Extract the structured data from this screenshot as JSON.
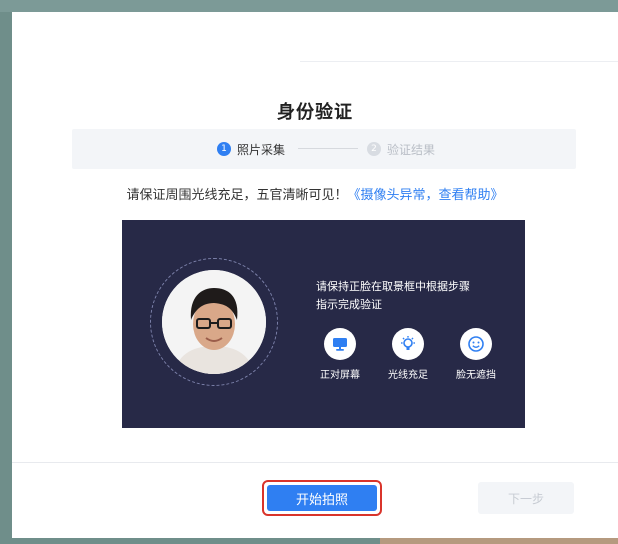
{
  "dialog": {
    "title": "身份验证",
    "steps": [
      {
        "index": "1",
        "label": "照片采集",
        "active": true
      },
      {
        "index": "2",
        "label": "验证结果",
        "active": false
      }
    ],
    "notice_text": "请保证周围光线充足，五官清晰可见！",
    "help_link": "《摄像头异常，查看帮助》",
    "panel": {
      "instruction_line1": "请保持正脸在取景框中根据步骤",
      "instruction_line2": "指示完成验证",
      "tips": [
        {
          "icon": "monitor-icon",
          "label": "正对屏幕"
        },
        {
          "icon": "lightbulb-icon",
          "label": "光线充足"
        },
        {
          "icon": "smile-face-icon",
          "label": "脸无遮挡"
        }
      ]
    },
    "buttons": {
      "start": "开始拍照",
      "next": "下一步"
    }
  },
  "colors": {
    "accent": "#2f7ff2",
    "panel_bg": "#272947",
    "highlight_border": "#d9342b"
  }
}
